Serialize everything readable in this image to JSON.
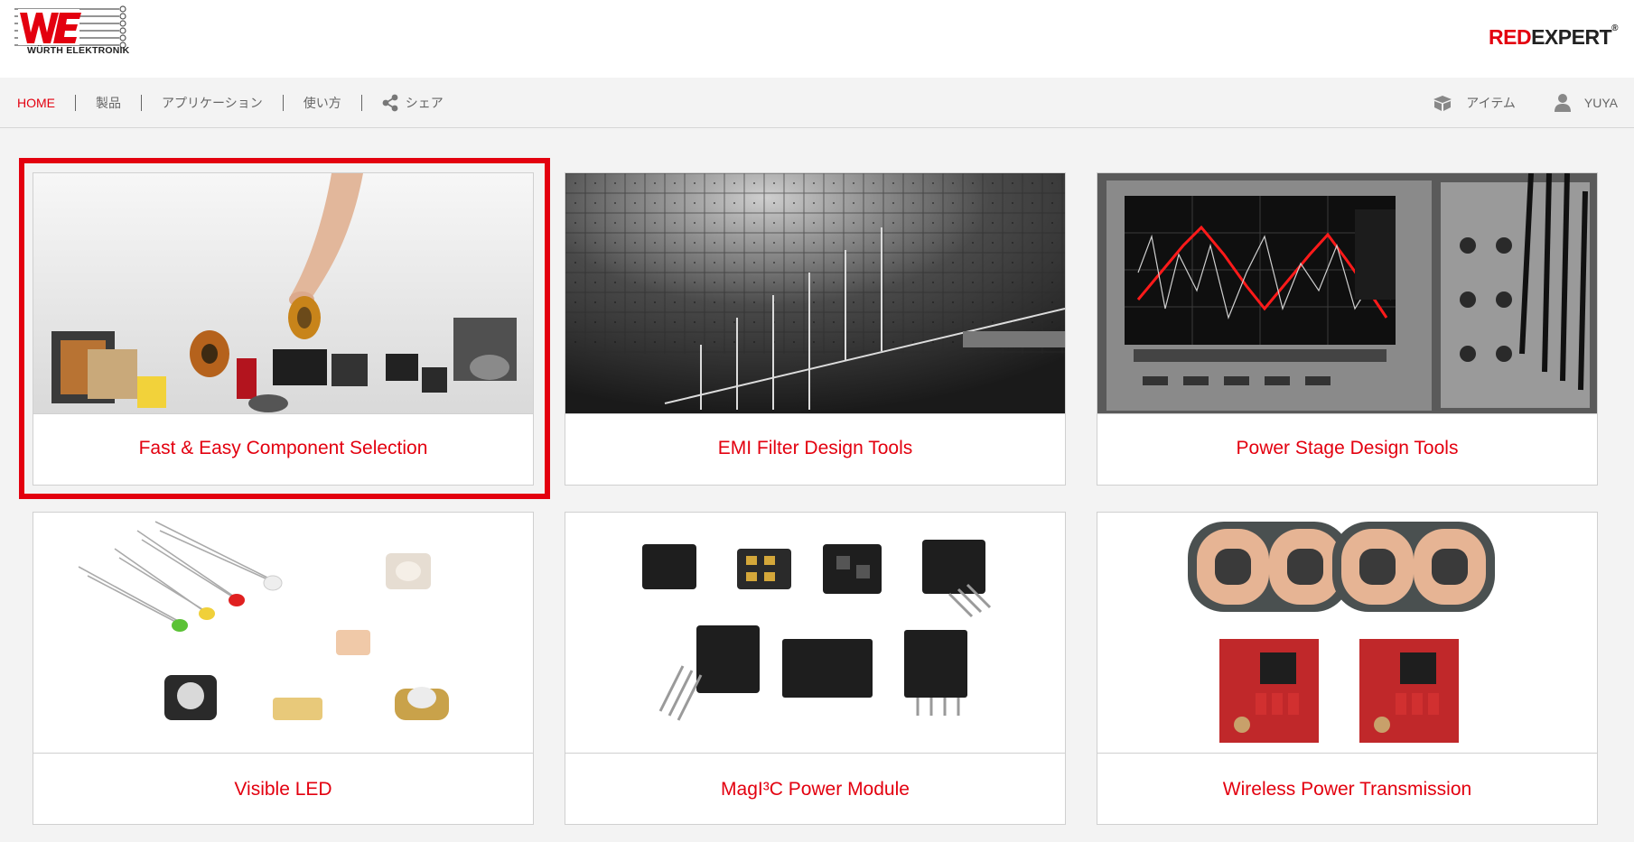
{
  "brand": {
    "logo_text": "WÜRTH ELEKTRONIK",
    "product_red": "RED",
    "product_dark": "EXPERT",
    "product_mark": "®",
    "accent_color": "#e3000f"
  },
  "nav": {
    "items": [
      {
        "label": "HOME",
        "active": true
      },
      {
        "label": "製品",
        "active": false
      },
      {
        "label": "アプリケーション",
        "active": false
      },
      {
        "label": "使い方",
        "active": false
      },
      {
        "label": "シェア",
        "icon": "share-icon",
        "active": false
      }
    ],
    "right": [
      {
        "label": "アイテム",
        "icon": "box-icon"
      },
      {
        "label": "YUYA",
        "icon": "user-icon"
      }
    ]
  },
  "cards": [
    {
      "label": "Fast & Easy Component Selection",
      "image": "components-hand-image",
      "selected": true
    },
    {
      "label": "EMI Filter Design Tools",
      "image": "emi-antenna-image"
    },
    {
      "label": "Power Stage Design Tools",
      "image": "oscilloscope-image"
    },
    {
      "label": "Visible LED",
      "image": "led-image"
    },
    {
      "label": "MagI³C Power Module",
      "image": "power-module-image"
    },
    {
      "label": "Wireless Power Transmission",
      "image": "wireless-coil-image"
    }
  ]
}
